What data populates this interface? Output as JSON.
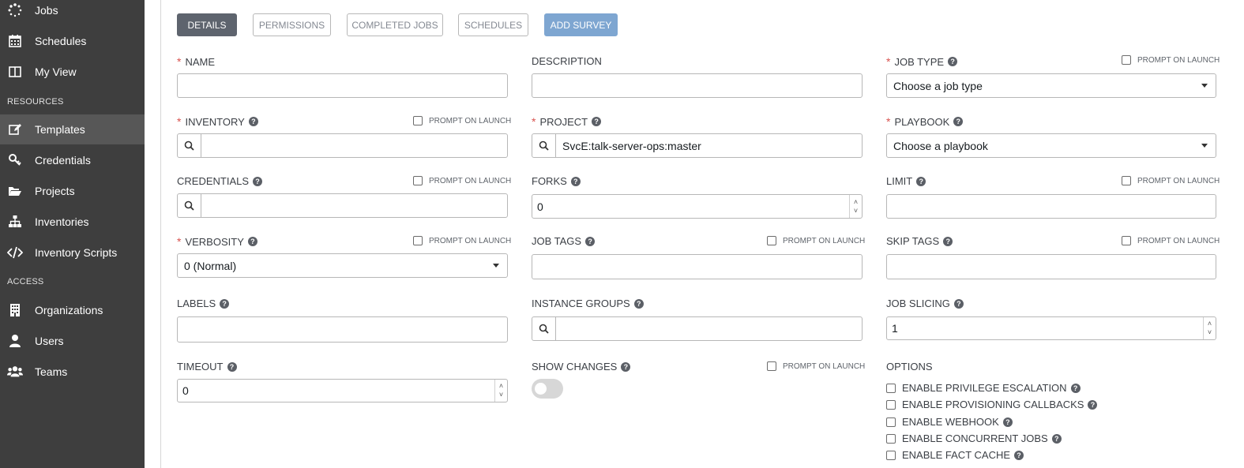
{
  "sidebar": {
    "items_top": [
      {
        "label": "Jobs",
        "icon": "jobs-spinner-icon"
      },
      {
        "label": "Schedules",
        "icon": "calendar-icon"
      },
      {
        "label": "My View",
        "icon": "columns-icon"
      }
    ],
    "resources_header": "RESOURCES",
    "items_resources": [
      {
        "label": "Templates",
        "icon": "edit-icon",
        "active": true
      },
      {
        "label": "Credentials",
        "icon": "key-icon"
      },
      {
        "label": "Projects",
        "icon": "folder-open-icon"
      },
      {
        "label": "Inventories",
        "icon": "sitemap-icon"
      },
      {
        "label": "Inventory Scripts",
        "icon": "code-icon"
      }
    ],
    "access_header": "ACCESS",
    "items_access": [
      {
        "label": "Organizations",
        "icon": "building-icon"
      },
      {
        "label": "Users",
        "icon": "user-icon"
      },
      {
        "label": "Teams",
        "icon": "users-icon"
      }
    ]
  },
  "tabs": {
    "details": "DETAILS",
    "permissions": "PERMISSIONS",
    "completed_jobs": "COMPLETED JOBS",
    "schedules": "SCHEDULES",
    "add_survey": "ADD SURVEY"
  },
  "prompt_on_launch": "PROMPT ON LAUNCH",
  "form": {
    "name": {
      "label": "NAME",
      "value": ""
    },
    "description": {
      "label": "DESCRIPTION",
      "value": ""
    },
    "job_type": {
      "label": "JOB TYPE",
      "value": "Choose a job type"
    },
    "inventory": {
      "label": "INVENTORY",
      "value": ""
    },
    "project": {
      "label": "PROJECT",
      "value": "SvcE:talk-server-ops:master"
    },
    "playbook": {
      "label": "PLAYBOOK",
      "value": "Choose a playbook"
    },
    "credentials": {
      "label": "CREDENTIALS",
      "value": ""
    },
    "forks": {
      "label": "FORKS",
      "value": "0"
    },
    "limit": {
      "label": "LIMIT",
      "value": ""
    },
    "verbosity": {
      "label": "VERBOSITY",
      "value": "0 (Normal)"
    },
    "job_tags": {
      "label": "JOB TAGS",
      "value": ""
    },
    "skip_tags": {
      "label": "SKIP TAGS",
      "value": ""
    },
    "labels": {
      "label": "LABELS",
      "value": ""
    },
    "instance_groups": {
      "label": "INSTANCE GROUPS",
      "value": ""
    },
    "job_slicing": {
      "label": "JOB SLICING",
      "value": "1"
    },
    "timeout": {
      "label": "TIMEOUT",
      "value": "0"
    },
    "show_changes": {
      "label": "SHOW CHANGES",
      "on": false
    },
    "options": {
      "label": "OPTIONS",
      "items": [
        "ENABLE PRIVILEGE ESCALATION",
        "ENABLE PROVISIONING CALLBACKS",
        "ENABLE WEBHOOK",
        "ENABLE CONCURRENT JOBS",
        "ENABLE FACT CACHE"
      ]
    }
  }
}
